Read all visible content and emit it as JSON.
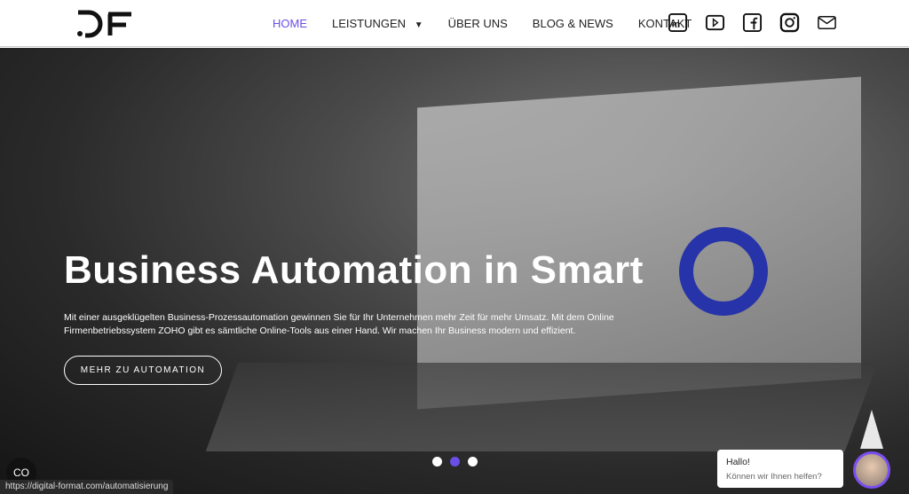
{
  "header": {
    "logo_text": "DF",
    "nav": [
      {
        "label": "HOME",
        "active": true
      },
      {
        "label": "LEISTUNGEN",
        "dropdown": true
      },
      {
        "label": "ÜBER UNS"
      },
      {
        "label": "BLOG & NEWS"
      },
      {
        "label": "KONTAKT"
      }
    ],
    "social": [
      "linkedin-icon",
      "youtube-icon",
      "facebook-icon",
      "instagram-icon",
      "mail-icon"
    ]
  },
  "hero": {
    "title": "Business Automation in Smart",
    "description": "Mit einer ausgeklügelten Business-Prozessautomation gewinnen Sie für Ihr Unternehmen mehr Zeit für mehr Umsatz. Mit dem Online Firmenbetriebssystem ZOHO gibt es sämtliche Online-Tools aus einer Hand. Wir machen Ihr Business modern und effizient.",
    "button": "MEHR ZU AUTOMATION",
    "slides": 3,
    "active_slide": 2
  },
  "widget": {
    "co_label": "CO"
  },
  "chat": {
    "greeting": "Hallo!",
    "subtext": "Können wir Ihnen helfen?"
  },
  "status_url": "https://digital-format.com/automatisierung",
  "colors": {
    "accent": "#6b4ee6"
  }
}
